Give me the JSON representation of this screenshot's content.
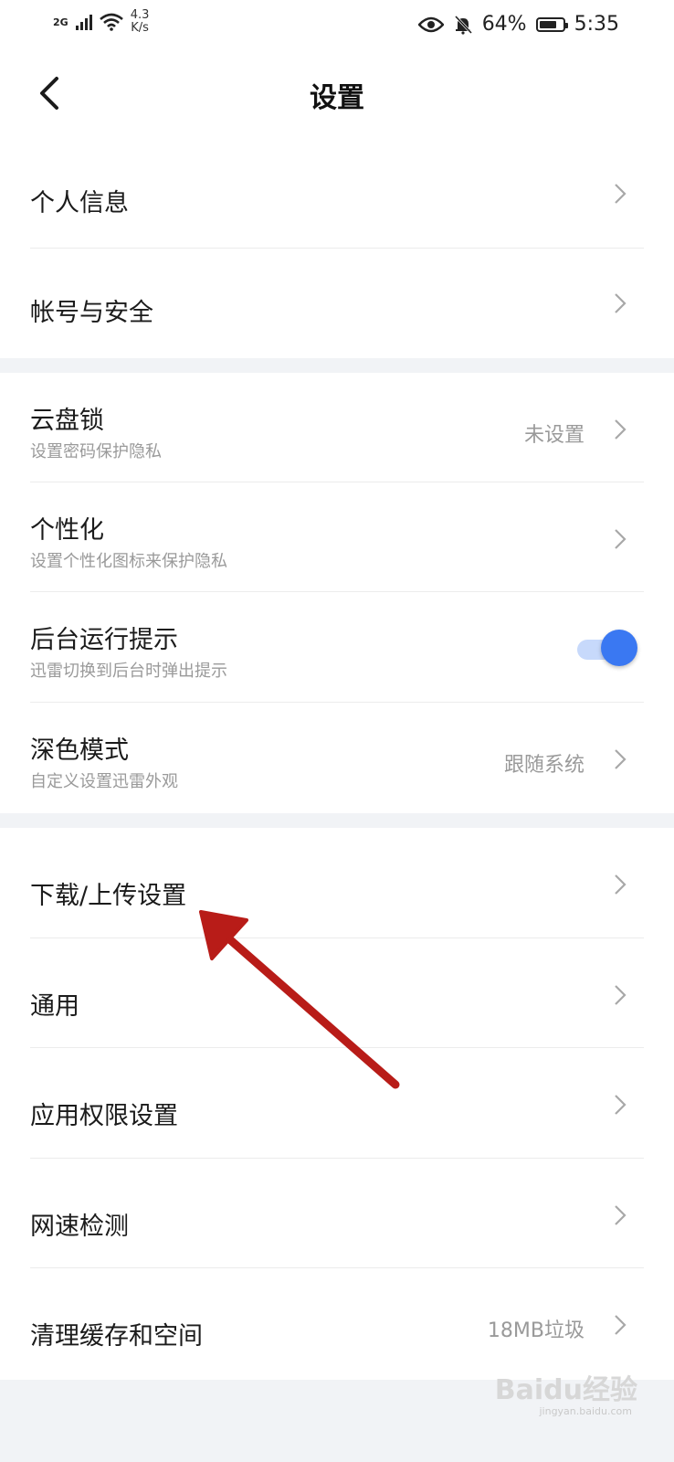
{
  "status_bar": {
    "network": "2G",
    "speed_value": "4.3",
    "speed_unit": "K/s",
    "battery": "64%",
    "time": "5:35",
    "icons": [
      "signal-icon",
      "wifi-icon",
      "eye-icon",
      "bell-muted-icon",
      "battery-icon"
    ]
  },
  "header": {
    "title": "设置",
    "back_icon": "back-chevron-icon"
  },
  "group1": [
    {
      "label": "个人信息"
    },
    {
      "label": "帐号与安全"
    }
  ],
  "group2": [
    {
      "label": "云盘锁",
      "sub": "设置密码保护隐私",
      "value": "未设置"
    },
    {
      "label": "个性化",
      "sub": "设置个性化图标来保护隐私"
    },
    {
      "label": "后台运行提示",
      "sub": "迅雷切换到后台时弹出提示",
      "toggle_on": true
    },
    {
      "label": "深色模式",
      "sub": "自定义设置迅雷外观",
      "value": "跟随系统"
    }
  ],
  "group3": [
    {
      "label": "下载/上传设置"
    },
    {
      "label": "通用"
    },
    {
      "label": "应用权限设置"
    },
    {
      "label": "网速检测"
    },
    {
      "label": "清理缓存和空间",
      "value": "18MB垃圾"
    }
  ],
  "watermark": {
    "text": "Baidu经验",
    "sub": "jingyan.baidu.com"
  },
  "colors": {
    "accent": "#3a78f2",
    "annotation_arrow": "#b81c18",
    "background": "#f1f3f6"
  }
}
